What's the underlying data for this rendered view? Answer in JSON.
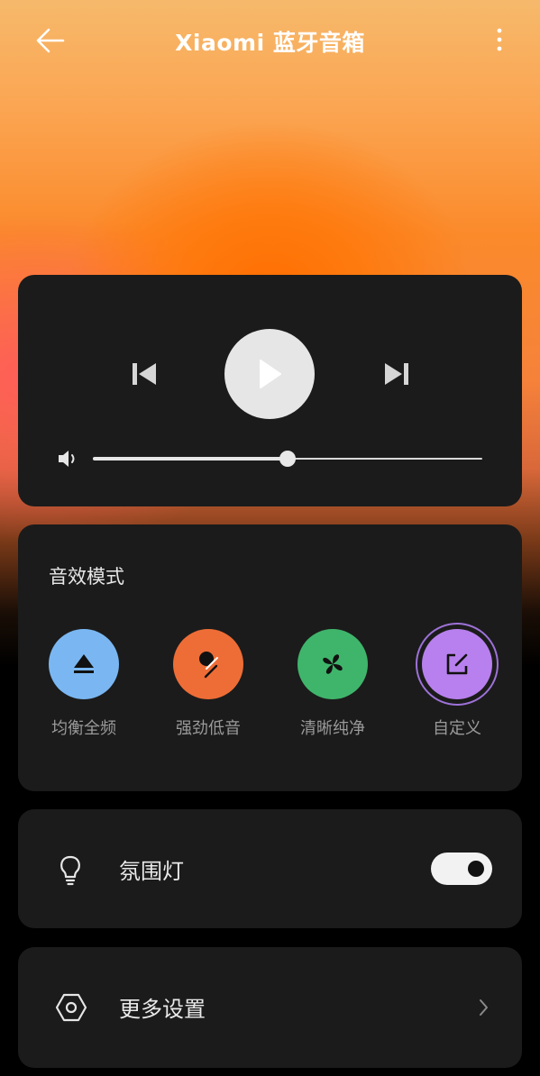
{
  "header": {
    "title": "Xiaomi 蓝牙音箱",
    "back_icon": "arrow-left-icon",
    "more_icon": "more-vertical-icon"
  },
  "player": {
    "prev_icon": "skip-previous-icon",
    "play_icon": "play-icon",
    "next_icon": "skip-next-icon",
    "volume_icon": "volume-icon",
    "volume_level": 0.5
  },
  "sound_effects": {
    "title": "音效模式",
    "modes": [
      {
        "label": "均衡全频",
        "icon": "eject-triangle-icon",
        "color": "#7ab7f2",
        "selected": false
      },
      {
        "label": "强劲低音",
        "icon": "bass-drum-stick-icon",
        "color": "#ee6d36",
        "selected": false
      },
      {
        "label": "清晰纯净",
        "icon": "clover-leaf-icon",
        "color": "#3fb56b",
        "selected": false
      },
      {
        "label": "自定义",
        "icon": "edit-square-icon",
        "color": "#b880ee",
        "selected": true
      }
    ]
  },
  "ambient_light": {
    "label": "氛围灯",
    "icon": "lightbulb-icon",
    "enabled": true
  },
  "more_settings": {
    "label": "更多设置",
    "icon": "hexagon-settings-icon",
    "chevron_icon": "chevron-right-icon"
  },
  "colors": {
    "card_bg": "#1b1b1b",
    "accent_orange": "#ff7a00"
  }
}
